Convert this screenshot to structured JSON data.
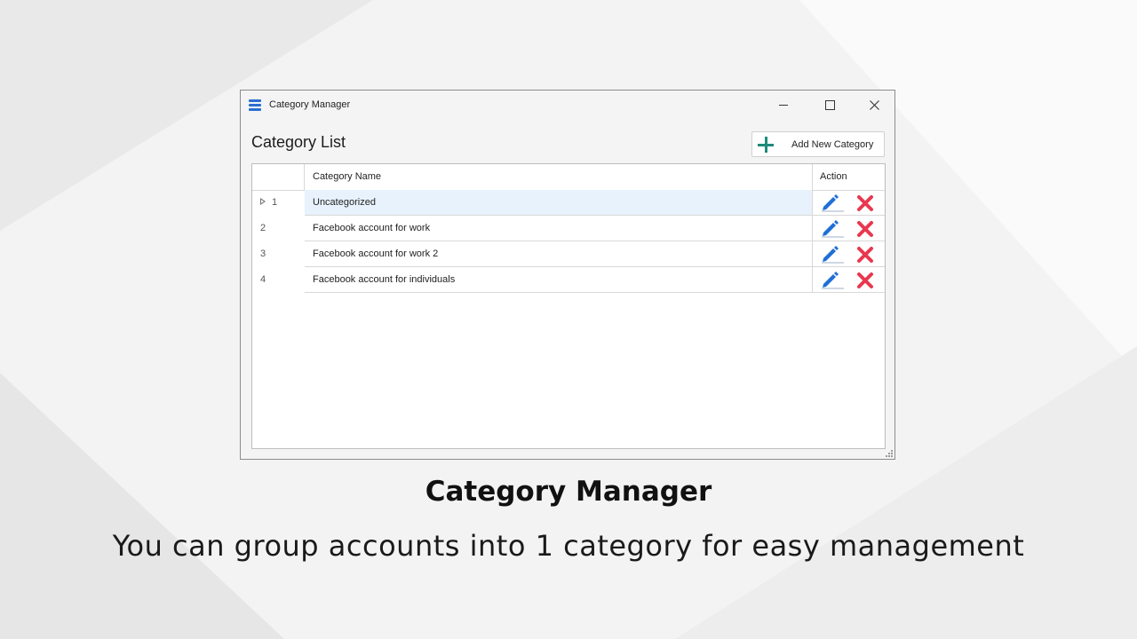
{
  "window": {
    "title": "Category Manager",
    "icon": "hamburger-list-icon",
    "controls": [
      "minimize-icon",
      "maximize-icon",
      "close-icon"
    ]
  },
  "header": {
    "title": "Category List",
    "add_button_label": "Add New Category",
    "add_button_icon": "plus-icon"
  },
  "grid": {
    "columns": [
      "",
      "Category Name",
      "Action"
    ],
    "rows": [
      {
        "num": "1",
        "name": "Uncategorized",
        "selected": true
      },
      {
        "num": "2",
        "name": "Facebook account for work",
        "selected": false
      },
      {
        "num": "3",
        "name": "Facebook account for work 2",
        "selected": false
      },
      {
        "num": "4",
        "name": "Facebook account for individuals",
        "selected": false
      }
    ],
    "action_icons": [
      "edit-pencil-icon",
      "delete-x-icon"
    ]
  },
  "caption": {
    "title": "Category Manager",
    "subtitle": "You can group accounts into 1 category for easy management"
  },
  "colors": {
    "accent_blue": "#2b6fd1",
    "add_green": "#1f8a7a",
    "delete_red": "#e8384f",
    "selected_row": "#e8f2fd"
  }
}
